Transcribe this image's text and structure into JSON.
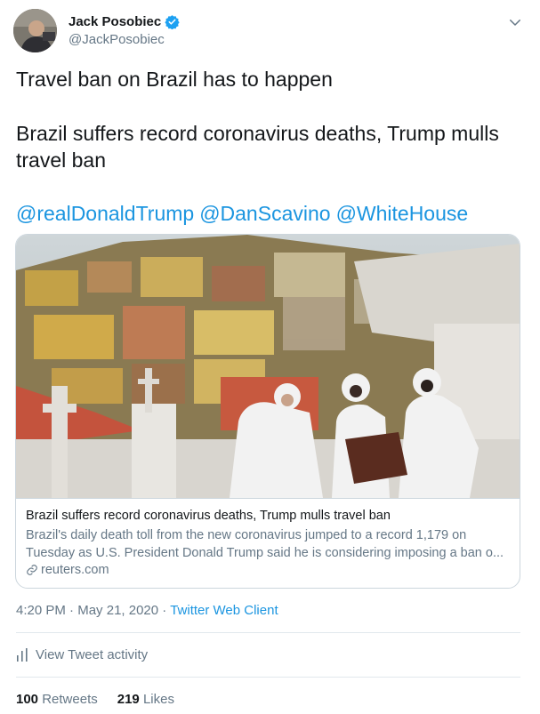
{
  "header": {
    "display_name": "Jack Posobiec",
    "handle": "@JackPosobiec",
    "verified": true,
    "avatar_icon": "user-avatar",
    "menu_icon": "chevron-down-icon"
  },
  "tweet": {
    "line1": "Travel ban on Brazil has to happen",
    "line2": "Brazil suffers record coronavirus deaths, Trump mulls travel ban",
    "mentions": [
      "@realDonaldTrump",
      "@DanScavino",
      "@WhiteHouse"
    ]
  },
  "card": {
    "title": "Brazil suffers record coronavirus deaths, Trump mulls travel ban",
    "description_line1": "Brazil's daily death toll from the new coronavirus jumped to a record 1,179 on",
    "description_line2": "Tuesday as U.S. President Donald Trump said he is considering imposing a ban o...",
    "domain": "reuters.com",
    "link_icon": "link-icon"
  },
  "meta": {
    "time": "4:20 PM",
    "separator1": " · ",
    "date": "May 21, 2020",
    "separator2": " · ",
    "client": "Twitter Web Client"
  },
  "activity": {
    "label": "View Tweet activity",
    "icon": "bar-chart-icon"
  },
  "stats": {
    "retweets_count": "100",
    "retweets_label": "Retweets",
    "likes_count": "219",
    "likes_label": "Likes"
  },
  "colors": {
    "link_blue": "#1b95e0",
    "secondary_text": "#657786",
    "primary_text": "#14171a",
    "border": "#ccd6dd"
  }
}
